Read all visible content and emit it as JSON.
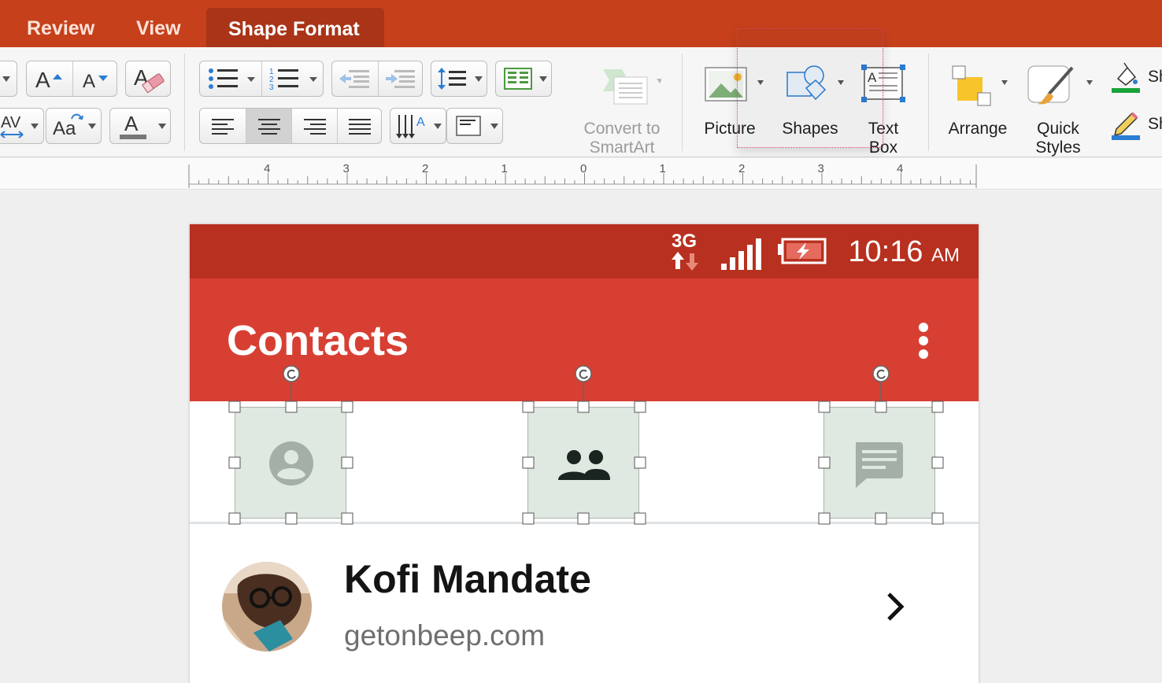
{
  "ribbon": {
    "tabs": [
      {
        "label": "Review"
      },
      {
        "label": "View"
      },
      {
        "label": "Shape Format"
      }
    ],
    "active_tab": "Shape Format",
    "convert_smartart": {
      "line1": "Convert to",
      "line2": "SmartArt"
    },
    "picture_label": "Picture",
    "shapes_label": "Shapes",
    "textbox": {
      "line1": "Text",
      "line2": "Box"
    },
    "arrange_label": "Arrange",
    "quick_styles": {
      "line1": "Quick",
      "line2": "Styles"
    },
    "shape_fill_partial": "Sh",
    "shape_outline_partial": "Sh",
    "font_color_letter": "A",
    "char_spacing": "AV",
    "change_case": "Aa"
  },
  "ruler": {
    "labels": [
      "4",
      "3",
      "2",
      "1",
      "0",
      "1",
      "2",
      "3",
      "4"
    ]
  },
  "phone": {
    "status": {
      "network": "3G",
      "time": "10:16",
      "ampm": "AM"
    },
    "app_title": "Contacts",
    "tab_icons": [
      "person-icon",
      "group-icon",
      "chat-icon"
    ],
    "contact": {
      "name": "Kofi Mandate",
      "website": "getonbeep.com"
    }
  },
  "colors": {
    "ribbon_tab_bar": "#c6401c",
    "active_tab": "#a93417",
    "status_bar": "#b83020",
    "app_bar": "#d83f33",
    "tile_fill": "#e0e9e1"
  }
}
